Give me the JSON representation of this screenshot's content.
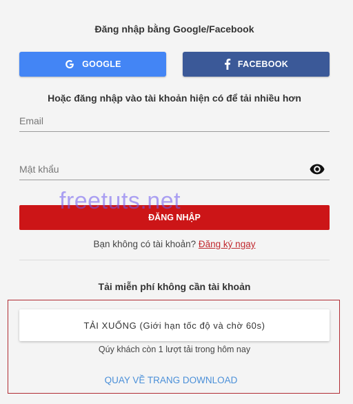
{
  "social_section": {
    "title": "Đăng nhập bằng Google/Facebook",
    "google_label": "GOOGLE",
    "facebook_label": "FACEBOOK",
    "google_color": "#4385f5",
    "facebook_color": "#3b5998"
  },
  "login_section": {
    "title": "Hoặc đăng nhập vào tài khoản hiện có để tải nhiều hơn",
    "email_placeholder": "Email",
    "password_placeholder": "Mật khẩu",
    "login_button": "ĐĂNG NHẬP",
    "login_color": "#cc1517",
    "signup_prompt": "Bạn không có tài khoản?",
    "signup_link": "Đăng ký ngay"
  },
  "watermark": "freetuts.net",
  "guest_section": {
    "title": "Tải miễn phí không cần tài khoản",
    "download_button": "TẢI XUỐNG (Giới hạn tốc độ và chờ 60s)",
    "quota_text": "Qúy khách còn 1 lượt tải trong hôm nay",
    "back_link": "QUAY VỀ TRANG DOWNLOAD"
  },
  "icons": [
    "google-icon",
    "facebook-icon",
    "eye-icon"
  ]
}
